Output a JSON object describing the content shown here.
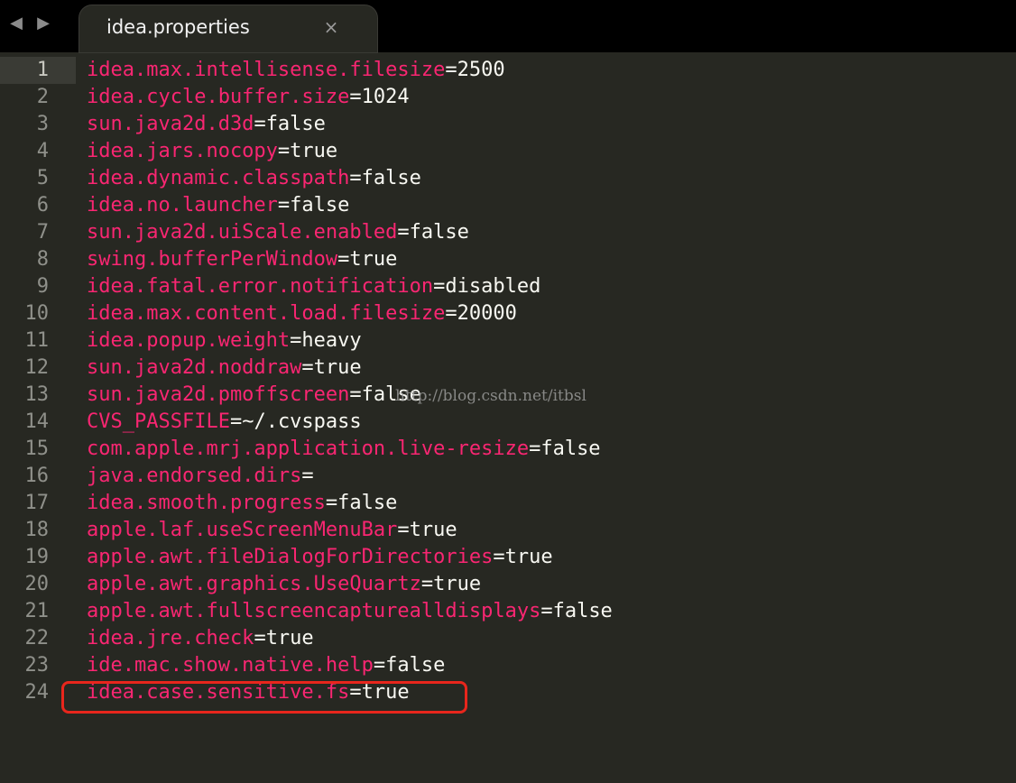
{
  "tab": {
    "title": "idea.properties",
    "close_glyph": "×"
  },
  "nav": {
    "back_icon": "arrow-left-icon",
    "forward_icon": "arrow-right-icon",
    "back_glyph": "◀",
    "forward_glyph": "▶"
  },
  "watermark": "http://blog.csdn.net/itbsl",
  "colors": {
    "key": "#f92672",
    "value": "#f8f8f2",
    "background": "#272822",
    "highlight_box": "#e8261c"
  },
  "current_line": 1,
  "highlighted_line": 24,
  "lines": [
    {
      "num": "1",
      "key": "idea.max.intellisense.filesize",
      "eq": "=",
      "value": "2500"
    },
    {
      "num": "2",
      "key": "idea.cycle.buffer.size",
      "eq": "=",
      "value": "1024"
    },
    {
      "num": "3",
      "key": "sun.java2d.d3d",
      "eq": "=",
      "value": "false"
    },
    {
      "num": "4",
      "key": "idea.jars.nocopy",
      "eq": "=",
      "value": "true"
    },
    {
      "num": "5",
      "key": "idea.dynamic.classpath",
      "eq": "=",
      "value": "false"
    },
    {
      "num": "6",
      "key": "idea.no.launcher",
      "eq": "=",
      "value": "false"
    },
    {
      "num": "7",
      "key": "sun.java2d.uiScale.enabled",
      "eq": "=",
      "value": "false"
    },
    {
      "num": "8",
      "key": "swing.bufferPerWindow",
      "eq": "=",
      "value": "true"
    },
    {
      "num": "9",
      "key": "idea.fatal.error.notification",
      "eq": "=",
      "value": "disabled"
    },
    {
      "num": "10",
      "key": "idea.max.content.load.filesize",
      "eq": "=",
      "value": "20000"
    },
    {
      "num": "11",
      "key": "idea.popup.weight",
      "eq": "=",
      "value": "heavy"
    },
    {
      "num": "12",
      "key": "sun.java2d.noddraw",
      "eq": "=",
      "value": "true"
    },
    {
      "num": "13",
      "key": "sun.java2d.pmoffscreen",
      "eq": "=",
      "value": "false"
    },
    {
      "num": "14",
      "key": "CVS_PASSFILE",
      "eq": "=",
      "value": "~/.cvspass"
    },
    {
      "num": "15",
      "key": "com.apple.mrj.application.live-resize",
      "eq": "=",
      "value": "false"
    },
    {
      "num": "16",
      "key": "java.endorsed.dirs",
      "eq": "=",
      "value": ""
    },
    {
      "num": "17",
      "key": "idea.smooth.progress",
      "eq": "=",
      "value": "false"
    },
    {
      "num": "18",
      "key": "apple.laf.useScreenMenuBar",
      "eq": "=",
      "value": "true"
    },
    {
      "num": "19",
      "key": "apple.awt.fileDialogForDirectories",
      "eq": "=",
      "value": "true"
    },
    {
      "num": "20",
      "key": "apple.awt.graphics.UseQuartz",
      "eq": "=",
      "value": "true"
    },
    {
      "num": "21",
      "key": "apple.awt.fullscreencapturealldisplays",
      "eq": "=",
      "value": "false"
    },
    {
      "num": "22",
      "key": "idea.jre.check",
      "eq": "=",
      "value": "true"
    },
    {
      "num": "23",
      "key": "ide.mac.show.native.help",
      "eq": "=",
      "value": "false"
    },
    {
      "num": "24",
      "key": "idea.case.sensitive.fs",
      "eq": "=",
      "value": "true"
    }
  ]
}
